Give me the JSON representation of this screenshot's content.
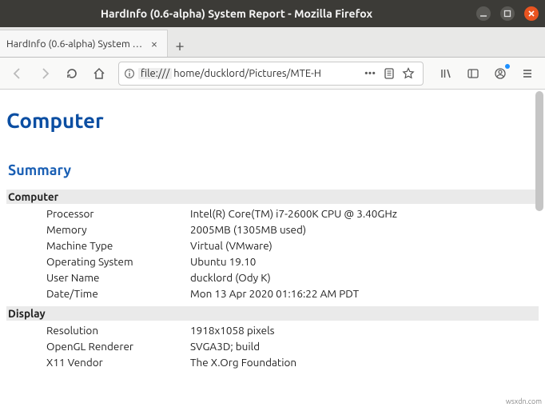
{
  "window": {
    "title": "HardInfo (0.6-alpha) System Report - Mozilla Firefox"
  },
  "tab": {
    "title": "HardInfo (0.6-alpha) System Report"
  },
  "url": {
    "scheme_badge": "file:///",
    "path_visible": "home/ducklord/Pictures/MTE-H"
  },
  "report": {
    "h1": "Computer",
    "h2": "Summary",
    "sections": [
      {
        "title": "Computer",
        "rows": [
          {
            "k": "Processor",
            "v": "Intel(R) Core(TM) i7-2600K CPU @ 3.40GHz"
          },
          {
            "k": "Memory",
            "v": "2005MB (1305MB used)"
          },
          {
            "k": "Machine Type",
            "v": "Virtual (VMware)"
          },
          {
            "k": "Operating System",
            "v": "Ubuntu 19.10"
          },
          {
            "k": "User Name",
            "v": "ducklord (Ody K)"
          },
          {
            "k": "Date/Time",
            "v": "Mon 13 Apr 2020 01:16:22 AM PDT"
          }
        ]
      },
      {
        "title": "Display",
        "rows": [
          {
            "k": "Resolution",
            "v": "1918x1058 pixels"
          },
          {
            "k": "OpenGL Renderer",
            "v": "SVGA3D; build"
          },
          {
            "k": "X11 Vendor",
            "v": "The X.Org Foundation"
          }
        ]
      }
    ]
  },
  "watermark": "wsxdn.com"
}
